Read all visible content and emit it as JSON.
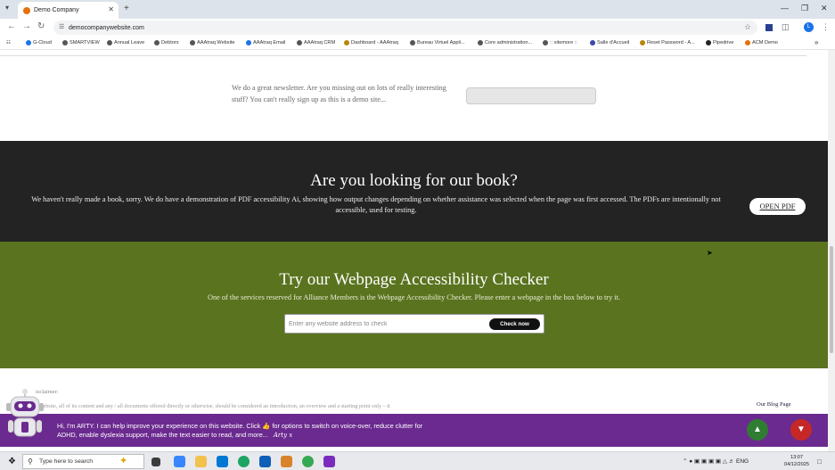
{
  "browser": {
    "tab_title": "Demo Company",
    "url": "democompanywebsite.com",
    "profile_letter": "L",
    "bookmarks": [
      {
        "label": "G-Cloud",
        "color": "#1a73e8"
      },
      {
        "label": "SMARTVIEW",
        "color": "#555555"
      },
      {
        "label": "Annual Leave",
        "color": "#555555"
      },
      {
        "label": "Debtors",
        "color": "#555555"
      },
      {
        "label": "AAAtraq Website",
        "color": "#555555"
      },
      {
        "label": "AAAtraq Email",
        "color": "#1a73e8"
      },
      {
        "label": "AAAtraq CRM",
        "color": "#555555"
      },
      {
        "label": "Dashboard - AAAtraq",
        "color": "#b8860b"
      },
      {
        "label": "Bureau Virtuel Appli...",
        "color": "#555555"
      },
      {
        "label": "Core administration...",
        "color": "#555555"
      },
      {
        "label": ":: sitemore ::",
        "color": "#555555"
      },
      {
        "label": "Salle d'Accueil",
        "color": "#3949ab"
      },
      {
        "label": "Reset Password - A...",
        "color": "#b8860b"
      },
      {
        "label": "Pipedrive",
        "color": "#222222"
      },
      {
        "label": "ACM Demo",
        "color": "#e8710a"
      }
    ]
  },
  "newsletter": {
    "text": "We do a great newsletter. Are you missing out on lots of really interesting stuff? You can't really sign up as this is a demo site..."
  },
  "book": {
    "heading": "Are you looking for our book?",
    "text": "We haven't really made a book, sorry. We do have a demonstration of PDF accessibility Ai, showing how output changes depending on whether assistance was selected when the page was first accessed. The PDFs are intentionally not accessible, used for testing.",
    "button_label": "OPEN PDF"
  },
  "checker": {
    "heading": "Try our Webpage Accessibility Checker",
    "text": "One of the services reserved for Alliance Members is the Webpage Accessibility Checker. Please enter a webpage in the box below to try it.",
    "input_placeholder": "Enter any website address to check",
    "button_label": "Check now"
  },
  "footer": {
    "disclaimer_label": "isclaimer:",
    "disclaimer_text": "website, all of its content and any / all documents offered directly or otherwise, should be considered an introduction, an overview and a starting point only – it",
    "blog_link": "Our Blog Page"
  },
  "arty": {
    "message": "Hi, I'm ARTY. I can help improve your experience on this website. Click 👍 for options to switch on voice-over, reduce clutter for ADHD, enable dyslexia support, make the text easier to read, and more...",
    "signature": "Arty x"
  },
  "taskbar": {
    "search_placeholder": "Type here to search",
    "language": "ENG",
    "time": "13:07",
    "date": "04/12/2025"
  }
}
